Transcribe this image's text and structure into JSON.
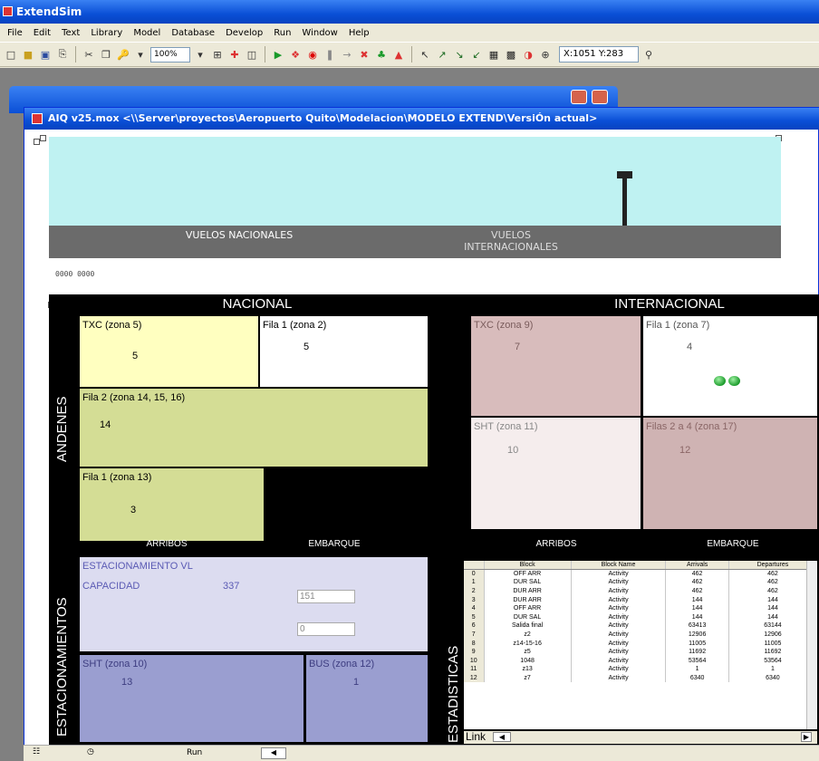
{
  "app": {
    "title": "ExtendSim"
  },
  "menu": [
    "File",
    "Edit",
    "Text",
    "Library",
    "Model",
    "Database",
    "Develop",
    "Run",
    "Window",
    "Help"
  ],
  "toolbar": {
    "zoom": "100%",
    "coords": "X:1051 Y:283"
  },
  "model_window": {
    "title": "AIQ v25.mox    <\\\\Server\\proyectos\\Aeropuerto Quito\\Modelacion\\MODELO EXTEND\\VersiÓn actual>"
  },
  "scene": {
    "label_nacionales": "VUELOS NACIONALES",
    "label_internacionales": "VUELOS INTERNACIONALES",
    "small_counters": "0000  0000"
  },
  "dashboard": {
    "nacional_header": "NACIONAL",
    "internacional_header": "INTERNACIONAL",
    "andenes_label": "ANDENES",
    "estacionamientos_label": "ESTACIONAMIENTOS",
    "estadisticas_label": "ESTADISTICAS",
    "arribos_label": "ARRIBOS",
    "embarque_label": "EMBARQUE",
    "nacional_zones": [
      {
        "label": "TXC (zona 5)",
        "value": "5"
      },
      {
        "label": "Fila 1 (zona 2)",
        "value": "5"
      },
      {
        "label": "Fila 2 (zona 14, 15, 16)",
        "value": "14"
      },
      {
        "label": "Fila 1 (zona 13)",
        "value": "3"
      }
    ],
    "internacional_zones": [
      {
        "label": "TXC (zona 9)",
        "value": "7"
      },
      {
        "label": "Fila 1 (zona 7)",
        "value": "4"
      },
      {
        "label": "SHT (zona 11)",
        "value": "10"
      },
      {
        "label": "Filas 2 a 4 (zona 17)",
        "value": "12"
      }
    ],
    "parking": {
      "title": "ESTACIONAMIENTO VL",
      "capacity_label": "CAPACIDAD",
      "capacity_value": "337",
      "field1_value": "151",
      "field2_value": "0",
      "sht_label": "SHT (zona 10)",
      "sht_value": "13",
      "bus_label": "BUS (zona 12)",
      "bus_value": "1"
    }
  },
  "stats_table": {
    "columns": [
      "",
      "Block",
      "Block Name",
      "Arrivals",
      "Departures"
    ],
    "rows": [
      [
        "0",
        "OFF ARR",
        "Activity",
        "462",
        "462"
      ],
      [
        "1",
        "DUR SAL",
        "Activity",
        "462",
        "462"
      ],
      [
        "2",
        "DUR ARR",
        "Activity",
        "462",
        "462"
      ],
      [
        "3",
        "DUR ARR",
        "Activity",
        "144",
        "144"
      ],
      [
        "4",
        "OFF ARR",
        "Activity",
        "144",
        "144"
      ],
      [
        "5",
        "DUR SAL",
        "Activity",
        "144",
        "144"
      ],
      [
        "6",
        "Salida final",
        "Activity",
        "63413",
        "63144"
      ],
      [
        "7",
        "z2",
        "Activity",
        "12906",
        "12906"
      ],
      [
        "8",
        "z14-15-16",
        "Activity",
        "11005",
        "11005"
      ],
      [
        "9",
        "z5",
        "Activity",
        "11692",
        "11692"
      ],
      [
        "10",
        "1048",
        "Activity",
        "53564",
        "53564"
      ],
      [
        "11",
        "z13",
        "Activity",
        "1",
        "1"
      ],
      [
        "12",
        "z7",
        "Activity",
        "6340",
        "6340"
      ]
    ],
    "link_label": "Link"
  },
  "statusbar": {
    "run_label": "Run"
  },
  "colors": {
    "nacional_txc": "#ffffc0",
    "nacional_fila1": "#ffffff",
    "nacional_fila2": "#d4dd95",
    "internacional_txc": "#d8bcbc",
    "internacional_sht": "#f5eded",
    "internacional_filas": "#cfb3b3",
    "parking": "#dcdcf0",
    "sht_bus": "#9a9ed0"
  }
}
